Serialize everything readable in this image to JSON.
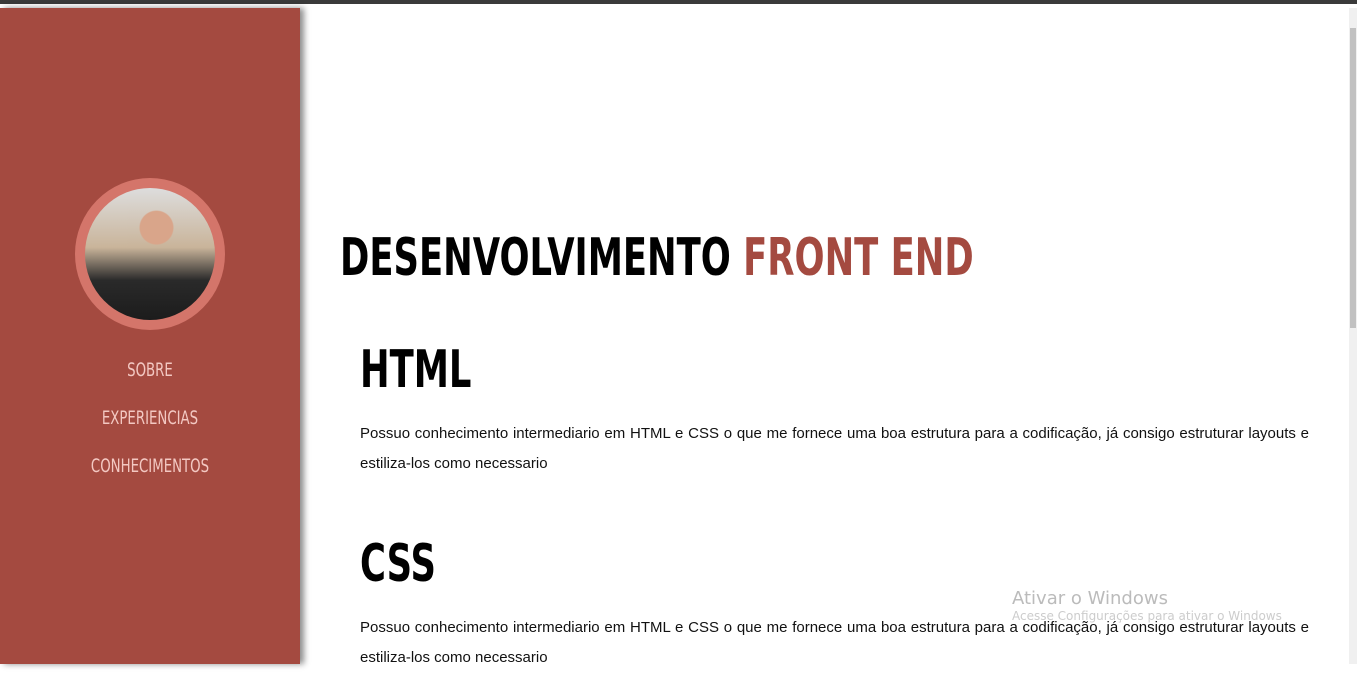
{
  "sidebar": {
    "nav": [
      "SOBRE",
      "EXPERIENCIAS",
      "CONHECIMENTOS"
    ],
    "accent": "#a44a40"
  },
  "main": {
    "title_black": "DESENVOLVIMENTO",
    "title_red": "FRONT END",
    "sections": [
      {
        "heading": "HTML",
        "text": "Possuo conhecimento intermediario em HTML e CSS o que me fornece uma boa estrutura para a codificação, já consigo estruturar layouts e estiliza-los como necessario"
      },
      {
        "heading": "CSS",
        "text": "Possuo conhecimento intermediario em HTML e CSS o que me fornece uma boa estrutura para a codificação, já consigo estruturar layouts e estiliza-los como necessario"
      }
    ]
  },
  "watermark": {
    "title": "Ativar o Windows",
    "subtitle": "Acesse Configurações para ativar o Windows"
  }
}
